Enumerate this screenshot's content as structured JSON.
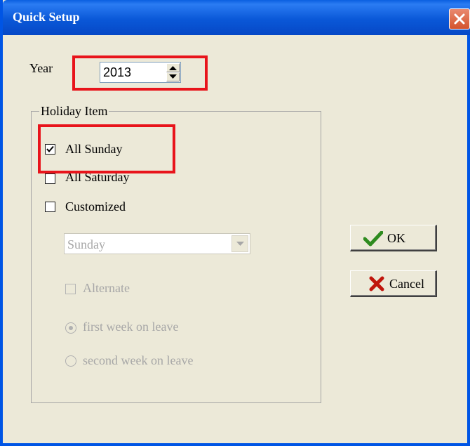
{
  "window": {
    "title": "Quick Setup"
  },
  "year": {
    "label": "Year",
    "value": "2013"
  },
  "holiday": {
    "group_label": "Holiday Item",
    "all_sunday": {
      "label": "All Sunday",
      "checked": true
    },
    "all_saturday": {
      "label": "All Saturday",
      "checked": false
    },
    "customized": {
      "label": "Customized",
      "checked": false
    },
    "day_select": {
      "value": "Sunday"
    },
    "alternate": {
      "label": "Alternate",
      "checked": false
    },
    "first_week": {
      "label": "first week on leave",
      "selected": true
    },
    "second_week": {
      "label": "second week on leave",
      "selected": false
    }
  },
  "buttons": {
    "ok": "OK",
    "cancel": "Cancel"
  },
  "icons": {
    "close": "close-icon",
    "spin_up": "arrow-up-icon",
    "spin_down": "arrow-down-icon",
    "combo_arrow": "chevron-down-icon",
    "ok": "checkmark-icon",
    "cancel": "cross-icon"
  },
  "colors": {
    "highlight": "#e8141b",
    "titlebar": "#0a58d8",
    "ok_icon": "#2e8b1f",
    "cancel_icon": "#c0150c"
  }
}
